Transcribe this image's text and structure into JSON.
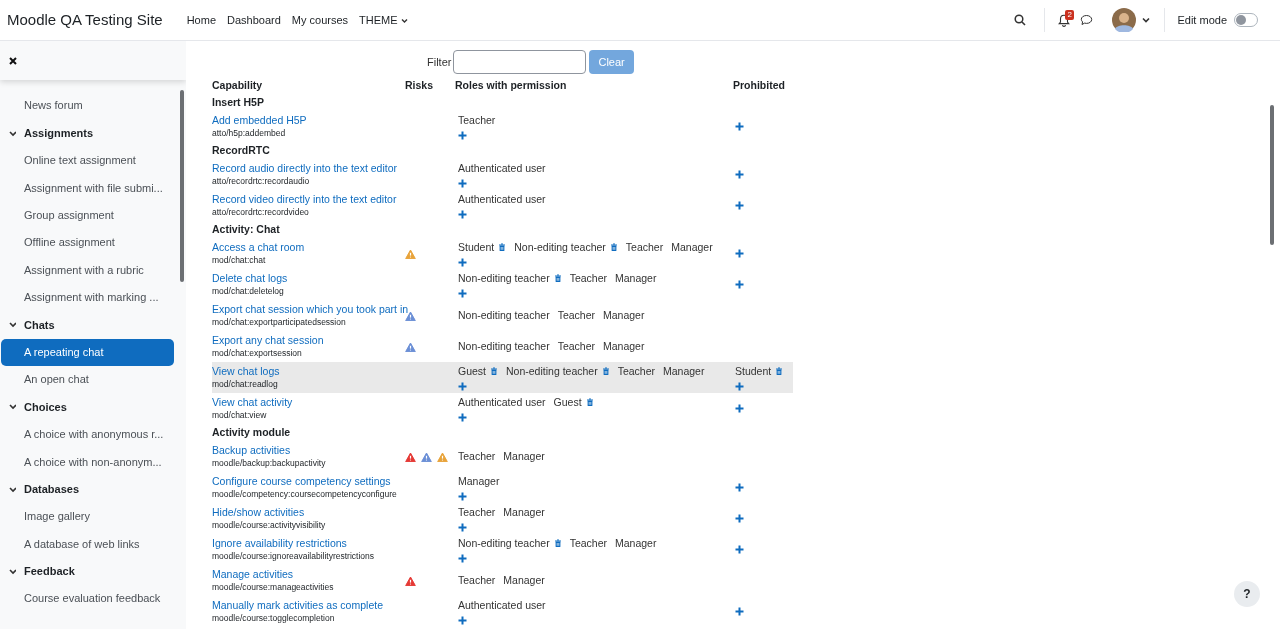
{
  "site_name": "Moodle QA Testing Site",
  "nav": [
    {
      "label": "Home",
      "dropdown": false
    },
    {
      "label": "Dashboard",
      "dropdown": false
    },
    {
      "label": "My courses",
      "dropdown": false
    },
    {
      "label": "THEME",
      "dropdown": true
    }
  ],
  "notification_count": "2",
  "edit_mode": {
    "label": "Edit mode",
    "on": false
  },
  "sidebar": {
    "entries": [
      {
        "kind": "activity",
        "label": "News forum",
        "selected": false
      },
      {
        "kind": "section",
        "label": "Assignments",
        "expanded": true
      },
      {
        "kind": "activity",
        "label": "Online text assignment",
        "selected": false
      },
      {
        "kind": "activity",
        "label": "Assignment with file submi...",
        "selected": false
      },
      {
        "kind": "activity",
        "label": "Group assignment",
        "selected": false
      },
      {
        "kind": "activity",
        "label": "Offline assignment",
        "selected": false
      },
      {
        "kind": "activity",
        "label": "Assignment with a rubric",
        "selected": false
      },
      {
        "kind": "activity",
        "label": "Assignment with marking ...",
        "selected": false
      },
      {
        "kind": "section",
        "label": "Chats",
        "expanded": true
      },
      {
        "kind": "activity",
        "label": "A repeating chat",
        "selected": true
      },
      {
        "kind": "activity",
        "label": "An open chat",
        "selected": false
      },
      {
        "kind": "section",
        "label": "Choices",
        "expanded": true
      },
      {
        "kind": "activity",
        "label": "A choice with anonymous r...",
        "selected": false
      },
      {
        "kind": "activity",
        "label": "A choice with non-anonym...",
        "selected": false
      },
      {
        "kind": "section",
        "label": "Databases",
        "expanded": true
      },
      {
        "kind": "activity",
        "label": "Image gallery",
        "selected": false
      },
      {
        "kind": "activity",
        "label": "A database of web links",
        "selected": false
      },
      {
        "kind": "section",
        "label": "Feedback",
        "expanded": true
      },
      {
        "kind": "activity",
        "label": "Course evaluation feedback",
        "selected": false
      }
    ]
  },
  "filter": {
    "label": "Filter"
  },
  "help_button": {
    "label": "?"
  },
  "clear_button": {
    "label": "Clear",
    "disabled": true
  },
  "table": {
    "columns": [
      "Capability",
      "Risks",
      "Roles with permission",
      "Prohibited"
    ],
    "rows": [
      {
        "kind": "group",
        "label": "Insert H5P"
      },
      {
        "kind": "capability",
        "name": "Add embedded H5P",
        "code": "atto/h5p:addembed",
        "risks": [],
        "roles": [
          {
            "label": "Teacher",
            "removable": false
          }
        ],
        "can_add": true,
        "prohibited": [],
        "can_prohibit": true,
        "highlighted": false
      },
      {
        "kind": "group",
        "label": "RecordRTC"
      },
      {
        "kind": "capability",
        "name": "Record audio directly into the text editor",
        "code": "atto/recordrtc:recordaudio",
        "risks": [],
        "roles": [
          {
            "label": "Authenticated user",
            "removable": false
          }
        ],
        "can_add": true,
        "prohibited": [],
        "can_prohibit": true,
        "highlighted": false
      },
      {
        "kind": "capability",
        "name": "Record video directly into the text editor",
        "code": "atto/recordrtc:recordvideo",
        "risks": [],
        "roles": [
          {
            "label": "Authenticated user",
            "removable": false
          }
        ],
        "can_add": true,
        "prohibited": [],
        "can_prohibit": true,
        "highlighted": false
      },
      {
        "kind": "group",
        "label": "Activity: Chat"
      },
      {
        "kind": "capability",
        "name": "Access a chat room",
        "code": "mod/chat:chat",
        "risks": [
          {
            "color": "#e8a33a"
          }
        ],
        "roles": [
          {
            "label": "Student",
            "removable": true
          },
          {
            "label": "Non-editing teacher",
            "removable": true
          },
          {
            "label": "Teacher",
            "removable": false
          },
          {
            "label": "Manager",
            "removable": false
          }
        ],
        "can_add": true,
        "prohibited": [],
        "can_prohibit": true,
        "highlighted": false
      },
      {
        "kind": "capability",
        "name": "Delete chat logs",
        "code": "mod/chat:deletelog",
        "risks": [],
        "roles": [
          {
            "label": "Non-editing teacher",
            "removable": true
          },
          {
            "label": "Teacher",
            "removable": false
          },
          {
            "label": "Manager",
            "removable": false
          }
        ],
        "can_add": true,
        "prohibited": [],
        "can_prohibit": true,
        "highlighted": false
      },
      {
        "kind": "capability",
        "name": "Export chat session which you took part in",
        "code": "mod/chat:exportparticipatedsession",
        "risks": [
          {
            "color": "#6b8fd6"
          }
        ],
        "roles": [
          {
            "label": "Non-editing teacher",
            "removable": false
          },
          {
            "label": "Teacher",
            "removable": false
          },
          {
            "label": "Manager",
            "removable": false
          }
        ],
        "can_add": false,
        "prohibited": [],
        "can_prohibit": false,
        "highlighted": false
      },
      {
        "kind": "capability",
        "name": "Export any chat session",
        "code": "mod/chat:exportsession",
        "risks": [
          {
            "color": "#6b8fd6"
          }
        ],
        "roles": [
          {
            "label": "Non-editing teacher",
            "removable": false
          },
          {
            "label": "Teacher",
            "removable": false
          },
          {
            "label": "Manager",
            "removable": false
          }
        ],
        "can_add": false,
        "prohibited": [],
        "can_prohibit": false,
        "highlighted": false
      },
      {
        "kind": "capability",
        "name": "View chat logs",
        "code": "mod/chat:readlog",
        "risks": [],
        "roles": [
          {
            "label": "Guest",
            "removable": true
          },
          {
            "label": "Non-editing teacher",
            "removable": true
          },
          {
            "label": "Teacher",
            "removable": false
          },
          {
            "label": "Manager",
            "removable": false
          }
        ],
        "can_add": true,
        "prohibited": [
          {
            "label": "Student",
            "removable": true
          }
        ],
        "can_prohibit": true,
        "highlighted": true
      },
      {
        "kind": "capability",
        "name": "View chat activity",
        "code": "mod/chat:view",
        "risks": [],
        "roles": [
          {
            "label": "Authenticated user",
            "removable": false
          },
          {
            "label": "Guest",
            "removable": true
          }
        ],
        "can_add": true,
        "prohibited": [],
        "can_prohibit": true,
        "highlighted": false
      },
      {
        "kind": "group",
        "label": "Activity module"
      },
      {
        "kind": "capability",
        "name": "Backup activities",
        "code": "moodle/backup:backupactivity",
        "risks": [
          {
            "color": "#e53935"
          },
          {
            "color": "#6b8fd6"
          },
          {
            "color": "#e8a33a"
          }
        ],
        "roles": [
          {
            "label": "Teacher",
            "removable": false
          },
          {
            "label": "Manager",
            "removable": false
          }
        ],
        "can_add": false,
        "prohibited": [],
        "can_prohibit": false,
        "highlighted": false
      },
      {
        "kind": "capability",
        "name": "Configure course competency settings",
        "code": "moodle/competency:coursecompetencyconfigure",
        "risks": [],
        "roles": [
          {
            "label": "Manager",
            "removable": false
          }
        ],
        "can_add": true,
        "prohibited": [],
        "can_prohibit": true,
        "highlighted": false
      },
      {
        "kind": "capability",
        "name": "Hide/show activities",
        "code": "moodle/course:activityvisibility",
        "risks": [],
        "roles": [
          {
            "label": "Teacher",
            "removable": false
          },
          {
            "label": "Manager",
            "removable": false
          }
        ],
        "can_add": true,
        "prohibited": [],
        "can_prohibit": true,
        "highlighted": false
      },
      {
        "kind": "capability",
        "name": "Ignore availability restrictions",
        "code": "moodle/course:ignoreavailabilityrestrictions",
        "risks": [],
        "roles": [
          {
            "label": "Non-editing teacher",
            "removable": true
          },
          {
            "label": "Teacher",
            "removable": false
          },
          {
            "label": "Manager",
            "removable": false
          }
        ],
        "can_add": true,
        "prohibited": [],
        "can_prohibit": true,
        "highlighted": false
      },
      {
        "kind": "capability",
        "name": "Manage activities",
        "code": "moodle/course:manageactivities",
        "risks": [
          {
            "color": "#e53935"
          }
        ],
        "roles": [
          {
            "label": "Teacher",
            "removable": false
          },
          {
            "label": "Manager",
            "removable": false
          }
        ],
        "can_add": false,
        "prohibited": [],
        "can_prohibit": false,
        "highlighted": false
      },
      {
        "kind": "capability",
        "name": "Manually mark activities as complete",
        "code": "moodle/course:togglecompletion",
        "risks": [],
        "roles": [
          {
            "label": "Authenticated user",
            "removable": false
          }
        ],
        "can_add": true,
        "prohibited": [],
        "can_prohibit": true,
        "highlighted": false
      }
    ]
  }
}
